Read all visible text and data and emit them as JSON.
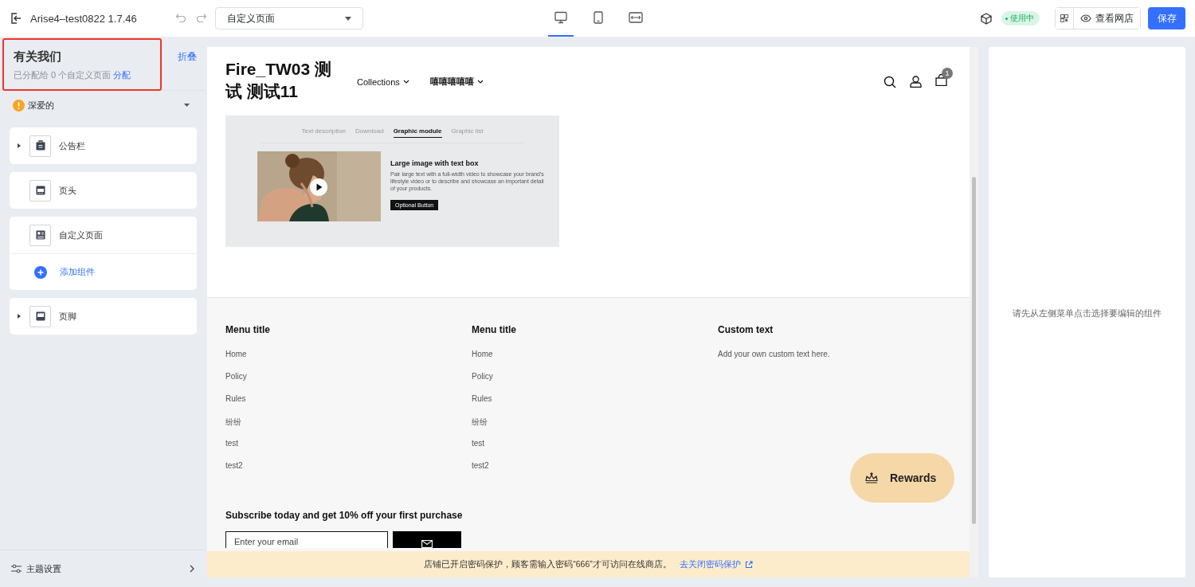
{
  "topbar": {
    "title": "Arise4–test0822 1.7.46",
    "page_select": "自定义页面",
    "devices": [
      {
        "kind": "desktop",
        "selected": true
      },
      {
        "kind": "tablet",
        "selected": false
      },
      {
        "kind": "fullscreen",
        "selected": false
      }
    ],
    "status_badge": "使用中",
    "view_store": "查看网店",
    "save": "保存"
  },
  "sidebar": {
    "page_title": "有关我们",
    "highlighted": true,
    "assigned": "已分配给 0 个自定义页面",
    "assign_link": "分配",
    "collapse": "折叠",
    "theme": "深爱的",
    "sections": [
      {
        "label": "公告栏",
        "kind": "bag",
        "has_children": true
      },
      {
        "label": "页头",
        "kind": "header",
        "has_children": false
      },
      {
        "label": "自定义页面",
        "kind": "page",
        "has_children": false,
        "add_label": "添加组件"
      },
      {
        "label": "页脚",
        "kind": "footer",
        "has_children": true
      }
    ],
    "theme_settings": "主题设置"
  },
  "preview": {
    "store_title": "Fire_TW03 测试 测试11",
    "nav": [
      {
        "label": "Collections"
      },
      {
        "label": "嘻嘻嘻嘻嘻"
      }
    ],
    "cart_count": "1",
    "module": {
      "tabs": [
        {
          "label": "Text description",
          "selected": false
        },
        {
          "label": "Download",
          "selected": false
        },
        {
          "label": "Graphic module",
          "selected": true
        },
        {
          "label": "Graphic list",
          "selected": false
        }
      ],
      "heading": "Large image with text box",
      "body": "Pair large text with a full-width video to showcase your brand's lifestyle video or to describe and showcase an important detail of your products.",
      "button": "Optional Button"
    },
    "footer": {
      "columns": [
        {
          "title": "Menu title",
          "links": [
            "Home",
            "Policy",
            "Rules",
            "纷纷",
            "test",
            "test2"
          ]
        },
        {
          "title": "Menu title",
          "links": [
            "Home",
            "Policy",
            "Rules",
            "纷纷",
            "test",
            "test2"
          ]
        },
        {
          "title": "Custom text",
          "text": "Add your own custom text here."
        }
      ],
      "subscribe_title": "Subscribe today and get 10% off your first purchase",
      "email_placeholder": "Enter your email"
    },
    "rewards": "Rewards",
    "banner": {
      "text": "店铺已开启密码保护，顾客需输入密码“666”才可访问在线商店。",
      "link": "去关闭密码保护"
    }
  },
  "right_panel": {
    "hint": "请先从左侧菜单点击选择要编辑的组件"
  }
}
